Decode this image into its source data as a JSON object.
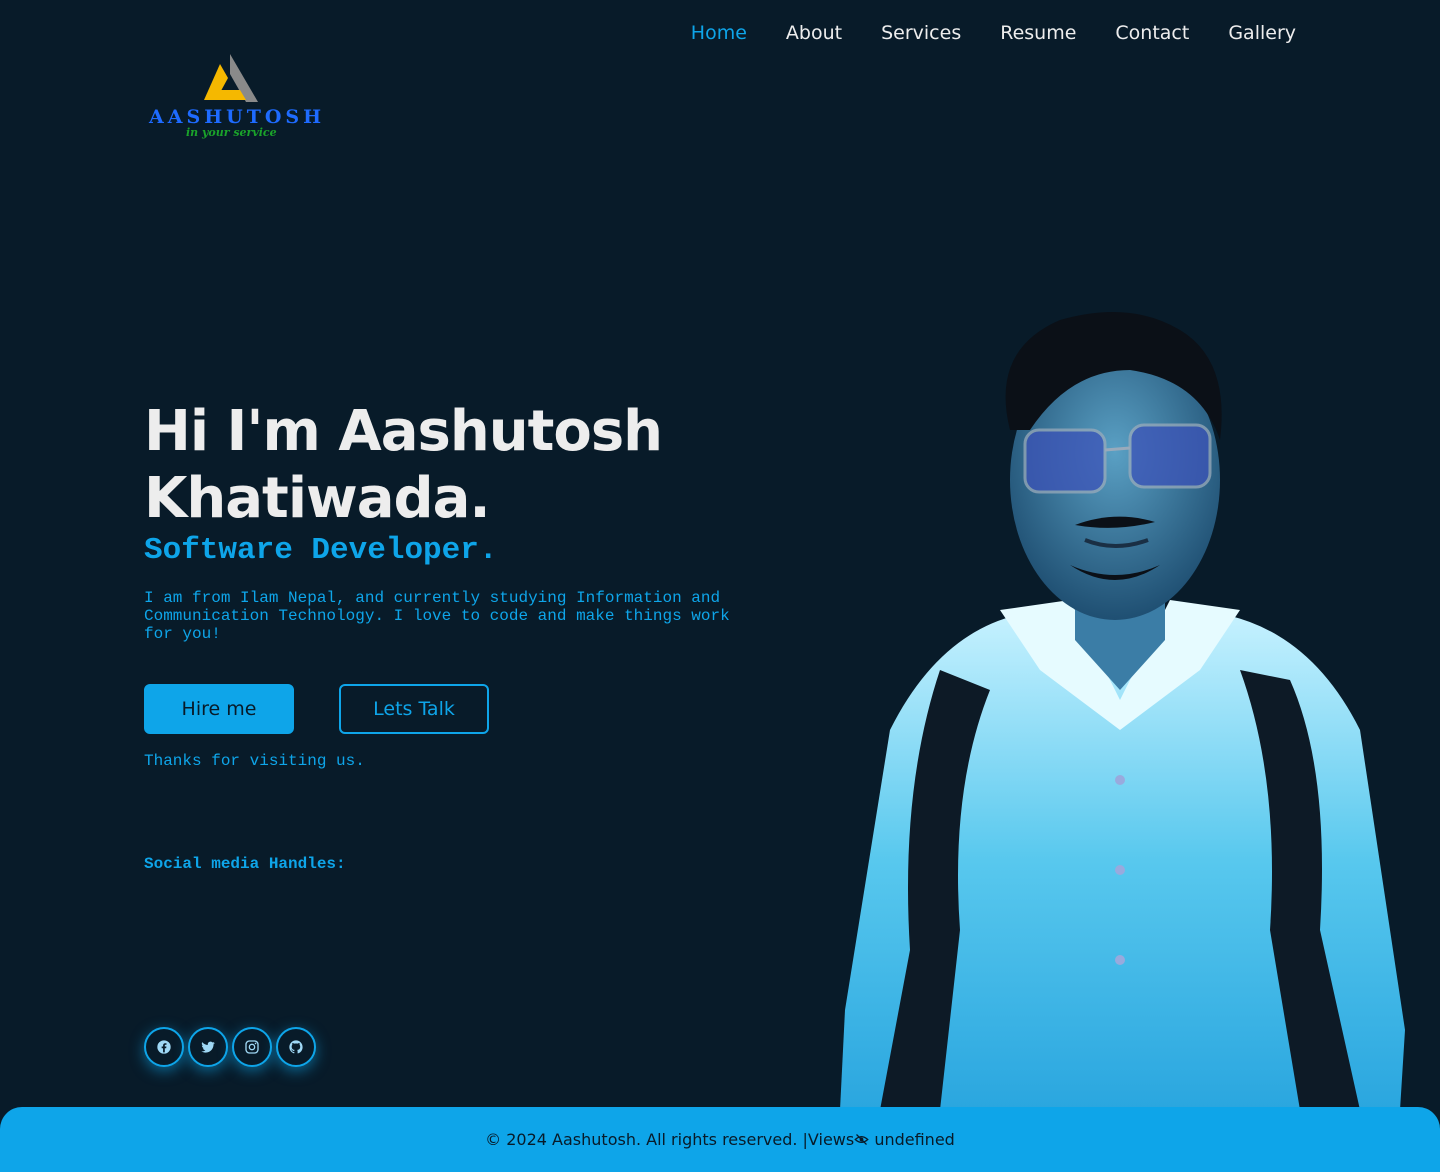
{
  "nav": {
    "items": [
      {
        "label": "Home",
        "active": true
      },
      {
        "label": "About",
        "active": false
      },
      {
        "label": "Services",
        "active": false
      },
      {
        "label": "Resume",
        "active": false
      },
      {
        "label": "Contact",
        "active": false
      },
      {
        "label": "Gallery",
        "active": false
      }
    ]
  },
  "logo": {
    "word": "AASHUTOSH",
    "tagline": "in your service",
    "icon": "triangle-logo-icon"
  },
  "hero": {
    "title": "Hi I'm Aashutosh Khatiwada.",
    "role": "Software Developer.",
    "description": "I am from Ilam Nepal, and currently studying Information and Communication Technology. I love to code and make things work for you!",
    "hire_label": "Hire me",
    "talk_label": "Lets Talk",
    "thanks": "Thanks for visiting us.",
    "social_heading": "Social media Handles:",
    "socials": [
      {
        "icon": "facebook-icon"
      },
      {
        "icon": "twitter-icon"
      },
      {
        "icon": "instagram-icon"
      },
      {
        "icon": "github-icon"
      }
    ],
    "portrait": "profile-photo"
  },
  "footer": {
    "copyright": "© 2024 Aashutosh. All rights reserved. |Views",
    "views_icon": "eye-off-icon",
    "views_value": " undefined"
  },
  "colors": {
    "background": "#081b29",
    "accent": "#0ea5e9",
    "text": "#ededed"
  }
}
